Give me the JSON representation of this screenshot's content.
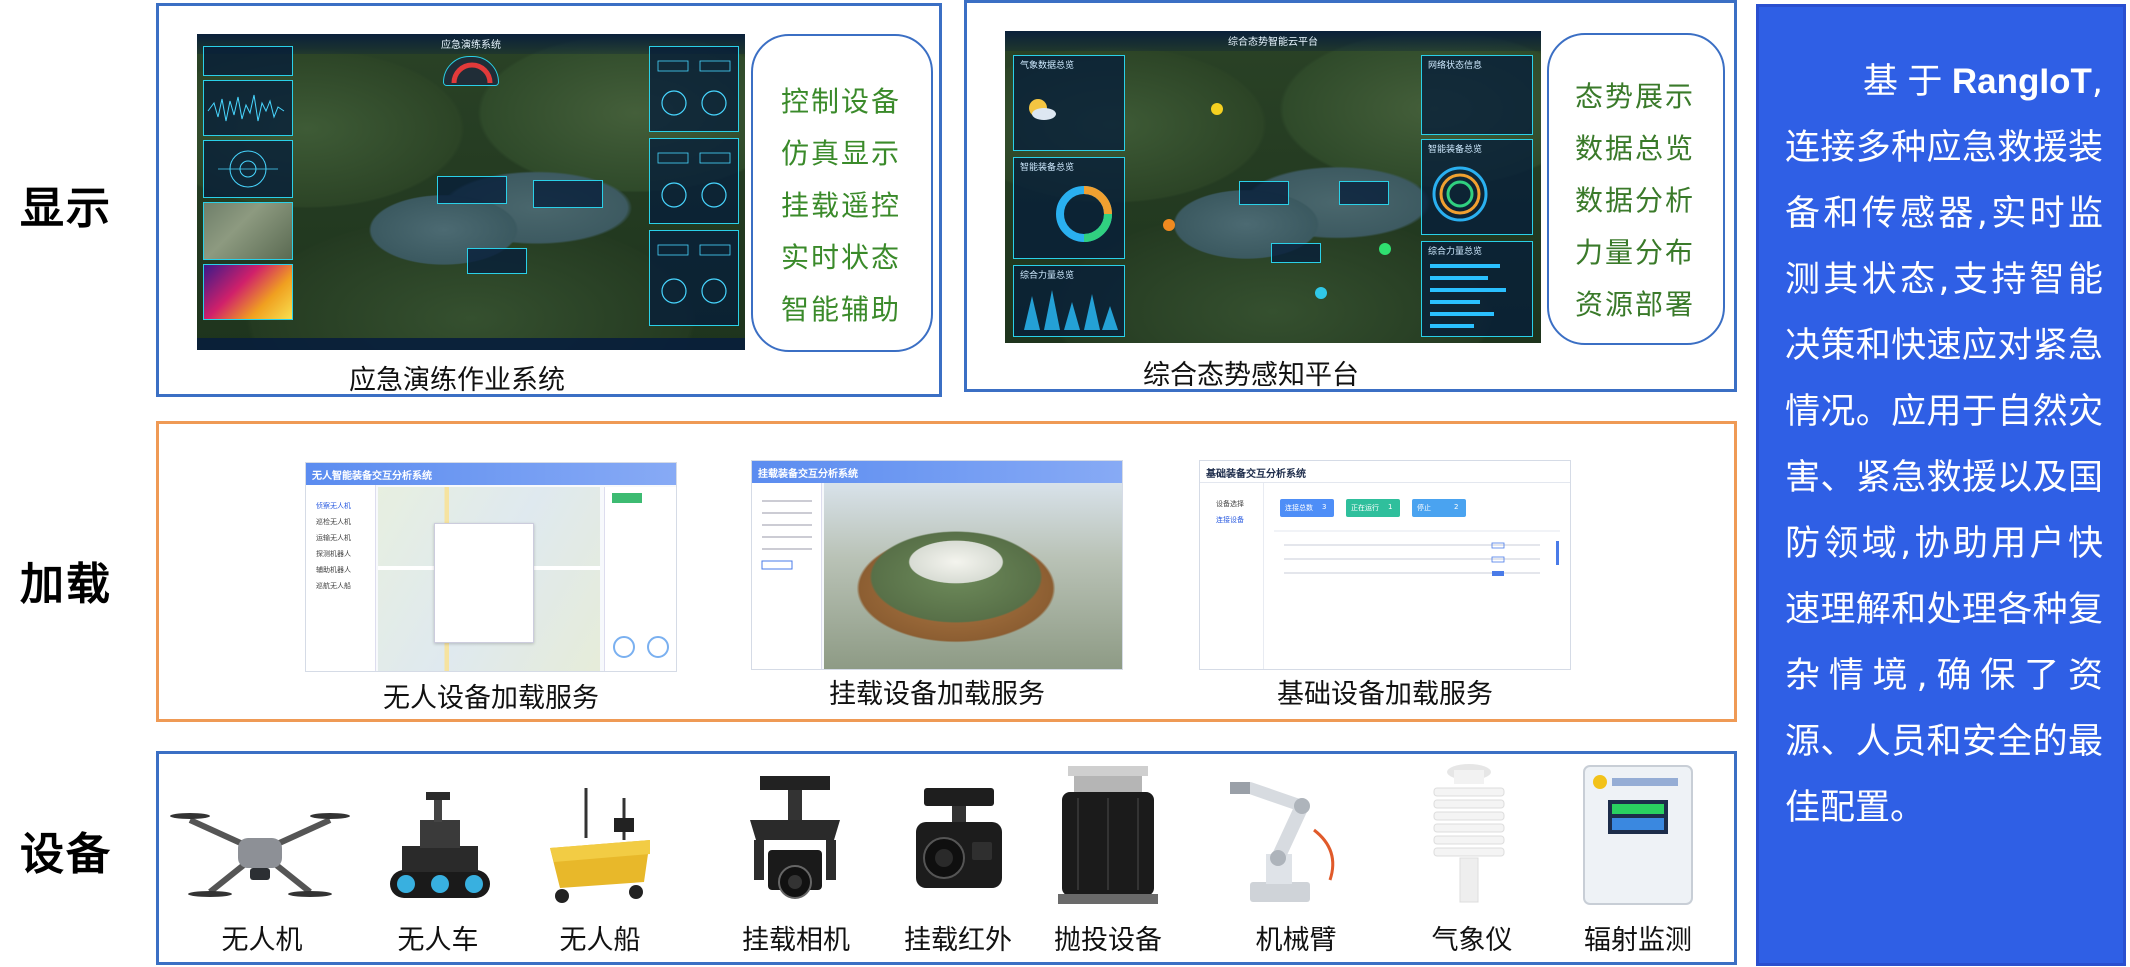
{
  "rows": {
    "display_label": "显示",
    "load_label": "加载",
    "equipment_label": "设备"
  },
  "display": {
    "system1": {
      "caption": "应急演练作业系统",
      "screen_title": "应急演练系统",
      "features": [
        "控制设备",
        "仿真显示",
        "挂载遥控",
        "实时状态",
        "智能辅助"
      ],
      "feature_color": "#3a8a2a"
    },
    "system2": {
      "caption": "综合态势感知平台",
      "screen_title": "综合态势智能云平台",
      "features": [
        "态势展示",
        "数据总览",
        "数据分析",
        "力量分布",
        "资源部署"
      ],
      "feature_color": "#3a7a2a",
      "hud_titles": [
        "气象数据总览",
        "智能装备总览",
        "综合力量总览",
        "网络状态信息",
        "智能装备总览",
        "综合力量总览"
      ]
    }
  },
  "load": {
    "app1": {
      "caption": "无人设备加载服务",
      "window_title": "无人智能装备交互分析系统",
      "menu": [
        "侦察无人机",
        "巡检无人机",
        "运输无人机",
        "探测机器人",
        "辅助机器人",
        "巡航无人船"
      ]
    },
    "app2": {
      "caption": "挂载设备加载服务",
      "window_title": "挂载装备交互分析系统"
    },
    "app3": {
      "caption": "基础设备加载服务",
      "window_title": "基础装备交互分析系统",
      "menu": [
        "设备选择",
        "连接设备"
      ],
      "stats": [
        {
          "label": "连接总数",
          "value": "3",
          "color": "#4e8ef7"
        },
        {
          "label": "正在运行",
          "value": "1",
          "color": "#2fbf9c"
        },
        {
          "label": "停止",
          "value": "2",
          "color": "#4aa3f0"
        }
      ]
    }
  },
  "equipment": {
    "items": [
      "无人机",
      "无人车",
      "无人船",
      "挂载相机",
      "挂载红外",
      "抛投设备",
      "机械臂",
      "气象仪",
      "辐射监测"
    ]
  },
  "description": {
    "prefix": "基于",
    "brand": "RangIoT",
    "body": ",连接多种应急救援装备和传感器,实时监测其状态,支持智能决策和快速应对紧急情况。应用于自然灾害、紧急救援以及国防领域,协助用户快速理解和处理各种复杂情境,确保了资源、人员和安全的最佳配置。"
  },
  "colors": {
    "panel_border": "#3b6fc4",
    "load_border": "#ef9a55",
    "desc_bg": "#2f5fe5",
    "feature_green": "#3a8a2a"
  }
}
